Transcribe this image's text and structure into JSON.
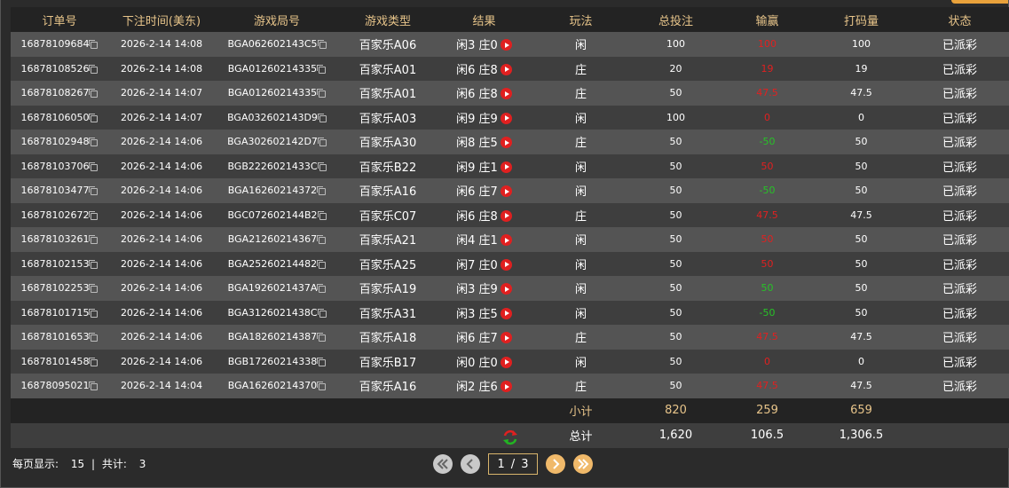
{
  "headers": [
    "订单号",
    "下注时间(美东)",
    "游戏局号",
    "游戏类型",
    "结果",
    "玩法",
    "总投注",
    "输赢",
    "打码量",
    "状态"
  ],
  "rows": [
    {
      "order": "16878109684",
      "time": "2026-2-14 14:08",
      "round": "BGA062602143C5",
      "game": "百家乐A06",
      "result": "闲3 庄0",
      "play": "闲",
      "bet": "100",
      "win": "100",
      "win_color": "red",
      "code": "100",
      "status": "已派彩"
    },
    {
      "order": "16878108526",
      "time": "2026-2-14 14:08",
      "round": "BGA01260214335",
      "game": "百家乐A01",
      "result": "闲6 庄8",
      "play": "庄",
      "bet": "20",
      "win": "19",
      "win_color": "red",
      "code": "19",
      "status": "已派彩"
    },
    {
      "order": "16878108267",
      "time": "2026-2-14 14:07",
      "round": "BGA01260214335",
      "game": "百家乐A01",
      "result": "闲6 庄8",
      "play": "庄",
      "bet": "50",
      "win": "47.5",
      "win_color": "red",
      "code": "47.5",
      "status": "已派彩"
    },
    {
      "order": "16878106050",
      "time": "2026-2-14 14:07",
      "round": "BGA032602143D9",
      "game": "百家乐A03",
      "result": "闲9 庄9",
      "play": "闲",
      "bet": "100",
      "win": "0",
      "win_color": "red",
      "code": "0",
      "status": "已派彩"
    },
    {
      "order": "16878102948",
      "time": "2026-2-14 14:06",
      "round": "BGA302602142D7",
      "game": "百家乐A30",
      "result": "闲8 庄5",
      "play": "庄",
      "bet": "50",
      "win": "-50",
      "win_color": "green",
      "code": "50",
      "status": "已派彩"
    },
    {
      "order": "16878103706",
      "time": "2026-2-14 14:06",
      "round": "BGB2226021433C",
      "game": "百家乐B22",
      "result": "闲9 庄1",
      "play": "闲",
      "bet": "50",
      "win": "50",
      "win_color": "red",
      "code": "50",
      "status": "已派彩"
    },
    {
      "order": "16878103477",
      "time": "2026-2-14 14:06",
      "round": "BGA16260214372",
      "game": "百家乐A16",
      "result": "闲6 庄7",
      "play": "闲",
      "bet": "50",
      "win": "-50",
      "win_color": "green",
      "code": "50",
      "status": "已派彩"
    },
    {
      "order": "16878102672",
      "time": "2026-2-14 14:06",
      "round": "BGC072602144B2",
      "game": "百家乐C07",
      "result": "闲6 庄8",
      "play": "庄",
      "bet": "50",
      "win": "47.5",
      "win_color": "red",
      "code": "47.5",
      "status": "已派彩"
    },
    {
      "order": "16878103261",
      "time": "2026-2-14 14:06",
      "round": "BGA21260214367",
      "game": "百家乐A21",
      "result": "闲4 庄1",
      "play": "闲",
      "bet": "50",
      "win": "50",
      "win_color": "red",
      "code": "50",
      "status": "已派彩"
    },
    {
      "order": "16878102153",
      "time": "2026-2-14 14:06",
      "round": "BGA25260214482",
      "game": "百家乐A25",
      "result": "闲7 庄0",
      "play": "闲",
      "bet": "50",
      "win": "50",
      "win_color": "red",
      "code": "50",
      "status": "已派彩"
    },
    {
      "order": "16878102253",
      "time": "2026-2-14 14:06",
      "round": "BGA1926021437A",
      "game": "百家乐A19",
      "result": "闲3 庄9",
      "play": "闲",
      "bet": "50",
      "win": "50",
      "win_color": "green",
      "code": "50",
      "status": "已派彩"
    },
    {
      "order": "16878101715",
      "time": "2026-2-14 14:06",
      "round": "BGA3126021438C",
      "game": "百家乐A31",
      "result": "闲3 庄5",
      "play": "闲",
      "bet": "50",
      "win": "-50",
      "win_color": "green",
      "code": "50",
      "status": "已派彩"
    },
    {
      "order": "16878101653",
      "time": "2026-2-14 14:06",
      "round": "BGA18260214387",
      "game": "百家乐A18",
      "result": "闲6 庄7",
      "play": "庄",
      "bet": "50",
      "win": "47.5",
      "win_color": "red",
      "code": "47.5",
      "status": "已派彩"
    },
    {
      "order": "16878101458",
      "time": "2026-2-14 14:06",
      "round": "BGB17260214338",
      "game": "百家乐B17",
      "result": "闲0 庄0",
      "play": "闲",
      "bet": "50",
      "win": "0",
      "win_color": "red",
      "code": "0",
      "status": "已派彩"
    },
    {
      "order": "16878095021",
      "time": "2026-2-14 14:04",
      "round": "BGA16260214370",
      "game": "百家乐A16",
      "result": "闲2 庄6",
      "play": "庄",
      "bet": "50",
      "win": "47.5",
      "win_color": "red",
      "code": "47.5",
      "status": "已派彩"
    }
  ],
  "subtotal": {
    "label": "小计",
    "bet": "820",
    "win": "259",
    "code": "659"
  },
  "total": {
    "label": "总计",
    "bet": "1,620",
    "win": "106.5",
    "code": "1,306.5"
  },
  "footer": {
    "per_page_label": "每页显示:",
    "per_page_value": "15",
    "separator": "|",
    "total_label": "共计:",
    "total_value": "3"
  },
  "pagination": {
    "current": "1",
    "sep": "/",
    "pages": "3"
  },
  "colors": {
    "accent": "#e7c48a",
    "win_red": "#e12020",
    "lose_green": "#27c227",
    "button_gold": "#f0b96a",
    "button_gray": "#c9c9c9"
  },
  "icons": [
    "copy-icon",
    "play-icon",
    "refresh-icon",
    "first-page-icon",
    "prev-page-icon",
    "next-page-icon",
    "last-page-icon"
  ]
}
